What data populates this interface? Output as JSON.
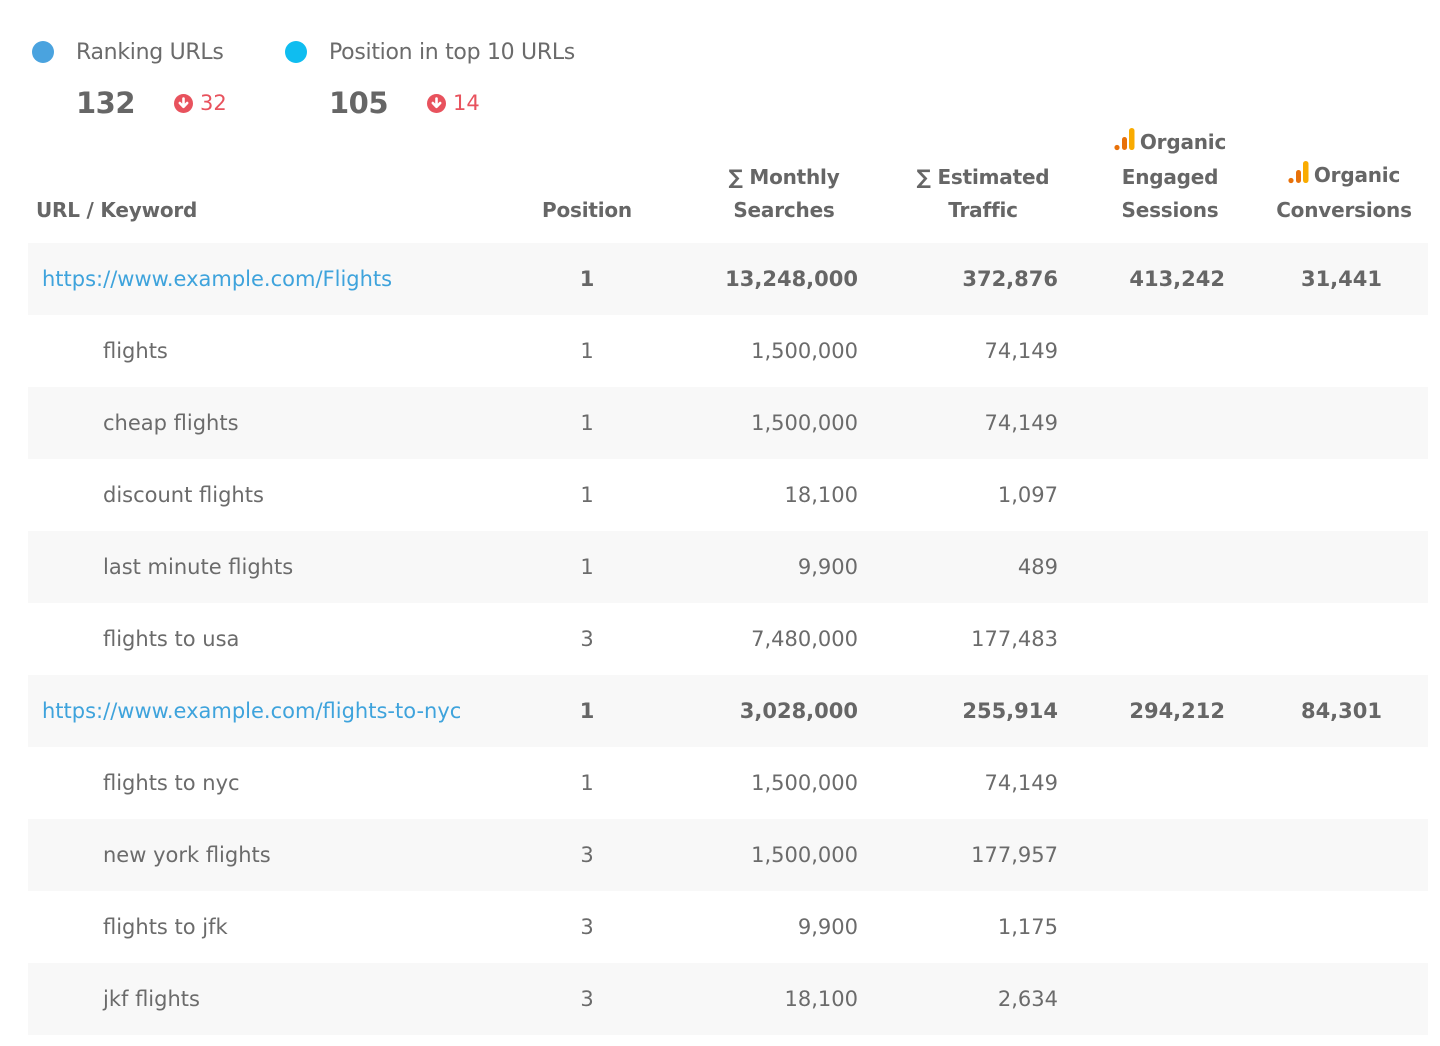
{
  "kpis": [
    {
      "label": "Ranking URLs",
      "value": "132",
      "delta": "32",
      "delta_direction": "down",
      "dot_color": "#4aa3df",
      "icon": "arrow-down-circle-icon"
    },
    {
      "label": "Position in top 10 URLs",
      "value": "105",
      "delta": "14",
      "delta_direction": "down",
      "dot_color": "#0fbdf0",
      "icon": "arrow-down-circle-icon"
    }
  ],
  "colors": {
    "link": "#3ea3dc",
    "negative": "#e8525d",
    "ga_dark": "#e8710a",
    "ga_light": "#f9ab00"
  },
  "table": {
    "headers": {
      "url": "URL / Keyword",
      "position": "Position",
      "monthly_searches": [
        "∑ Monthly",
        "Searches"
      ],
      "estimated_traffic": [
        "∑ Estimated",
        "Traffic"
      ],
      "engaged_sessions": [
        "Organic",
        "Engaged",
        "Sessions"
      ],
      "conversions": [
        "Organic",
        "Conversions"
      ]
    },
    "rows": [
      {
        "type": "url",
        "label": "https://www.example.com/Flights",
        "position": "1",
        "monthly_searches": "13,248,000",
        "estimated_traffic": "372,876",
        "engaged_sessions": "413,242",
        "conversions": "31,441"
      },
      {
        "type": "keyword",
        "label": "flights",
        "position": "1",
        "monthly_searches": "1,500,000",
        "estimated_traffic": "74,149",
        "engaged_sessions": "",
        "conversions": ""
      },
      {
        "type": "keyword",
        "label": "cheap flights",
        "position": "1",
        "monthly_searches": "1,500,000",
        "estimated_traffic": "74,149",
        "engaged_sessions": "",
        "conversions": ""
      },
      {
        "type": "keyword",
        "label": "discount flights",
        "position": "1",
        "monthly_searches": "18,100",
        "estimated_traffic": "1,097",
        "engaged_sessions": "",
        "conversions": ""
      },
      {
        "type": "keyword",
        "label": "last minute flights",
        "position": "1",
        "monthly_searches": "9,900",
        "estimated_traffic": "489",
        "engaged_sessions": "",
        "conversions": ""
      },
      {
        "type": "keyword",
        "label": "flights to usa",
        "position": "3",
        "monthly_searches": "7,480,000",
        "estimated_traffic": "177,483",
        "engaged_sessions": "",
        "conversions": ""
      },
      {
        "type": "url",
        "label": "https://www.example.com/flights-to-nyc",
        "position": "1",
        "monthly_searches": "3,028,000",
        "estimated_traffic": "255,914",
        "engaged_sessions": "294,212",
        "conversions": "84,301"
      },
      {
        "type": "keyword",
        "label": "flights to nyc",
        "position": "1",
        "monthly_searches": "1,500,000",
        "estimated_traffic": "74,149",
        "engaged_sessions": "",
        "conversions": ""
      },
      {
        "type": "keyword",
        "label": "new york flights",
        "position": "3",
        "monthly_searches": "1,500,000",
        "estimated_traffic": "177,957",
        "engaged_sessions": "",
        "conversions": ""
      },
      {
        "type": "keyword",
        "label": "flights to jfk",
        "position": "3",
        "monthly_searches": "9,900",
        "estimated_traffic": "1,175",
        "engaged_sessions": "",
        "conversions": ""
      },
      {
        "type": "keyword",
        "label": "jkf flights",
        "position": "3",
        "monthly_searches": "18,100",
        "estimated_traffic": "2,634",
        "engaged_sessions": "",
        "conversions": ""
      }
    ]
  }
}
